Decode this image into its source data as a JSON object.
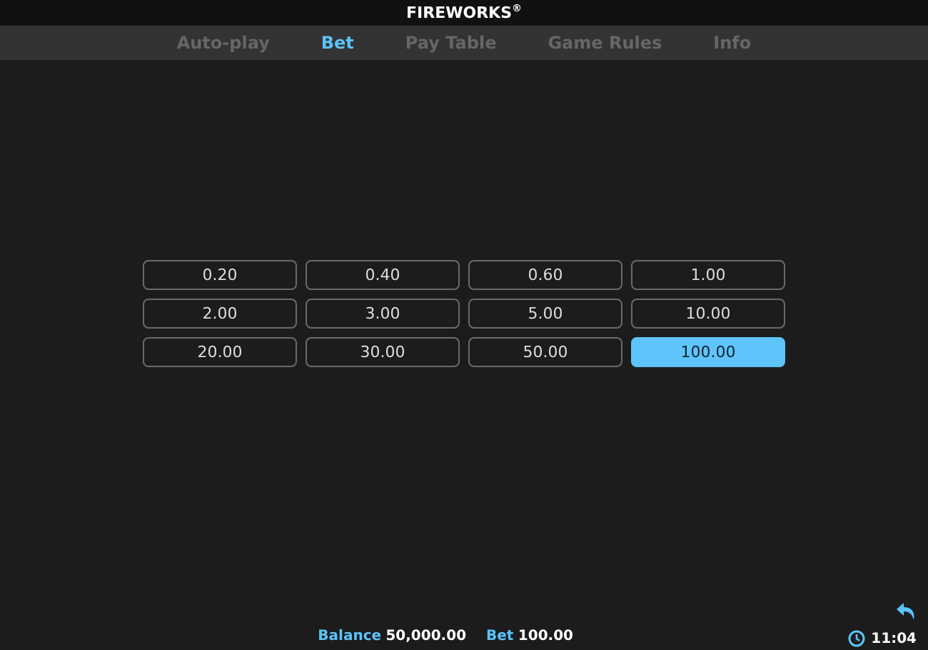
{
  "title": "FIREWORKS$^{®}$",
  "tabs": [
    {
      "label": "Auto-play",
      "selected": false
    },
    {
      "label": "Bet",
      "selected": true
    },
    {
      "label": "Pay Table",
      "selected": false
    },
    {
      "label": "Game Rules",
      "selected": false
    },
    {
      "label": "Info",
      "selected": false
    }
  ],
  "bets": [
    {
      "label": "0.20",
      "selected": false
    },
    {
      "label": "0.40",
      "selected": false
    },
    {
      "label": "0.60",
      "selected": false
    },
    {
      "label": "1.00",
      "selected": false
    },
    {
      "label": "2.00",
      "selected": false
    },
    {
      "label": "3.00",
      "selected": false
    },
    {
      "label": "5.00",
      "selected": false
    },
    {
      "label": "10.00",
      "selected": false
    },
    {
      "label": "20.00",
      "selected": false
    },
    {
      "label": "30.00",
      "selected": false
    },
    {
      "label": "50.00",
      "selected": false
    },
    {
      "label": "100.00",
      "selected": true
    }
  ],
  "status_bar": {
    "balance_label": "Balance",
    "balance": "50,000.00",
    "bet_label": "Bet",
    "bet": "100.00",
    "time": "11:04"
  }
}
